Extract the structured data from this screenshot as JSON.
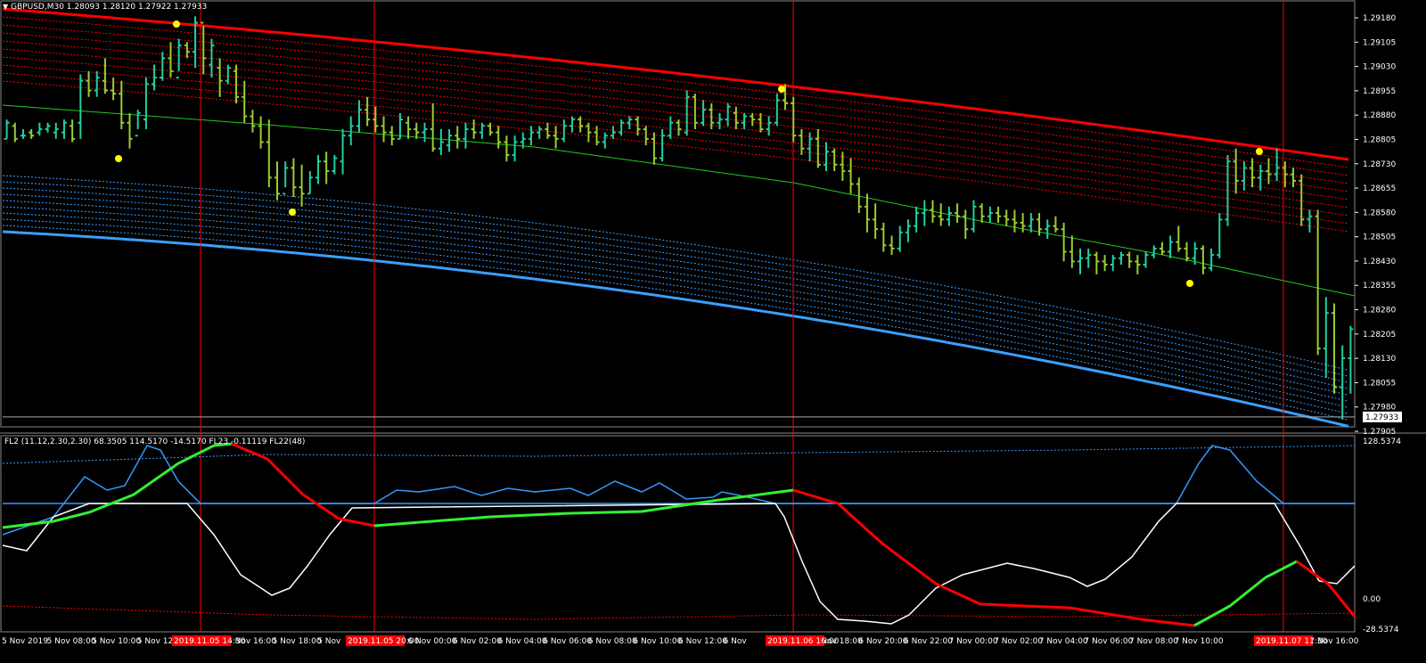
{
  "header": {
    "symbol_text": "GBPUSD,M30",
    "ohlc_text": "1.28093 1.28120 1.27922 1.27933",
    "menu_arrow": "triangle-down-icon"
  },
  "indicator_header": {
    "name_text": "FL2 (11.12,2.30,2.30) 68.3505 114.5170 -14.5170",
    "fl23_text": "FL23 -0.11119",
    "fl22_text": "FL22(48)"
  },
  "colors": {
    "background": "#000000",
    "bull_bar": "#20d0a0",
    "bear_bar": "#9acd32",
    "upper_band": "#ff0000",
    "lower_band": "#3aa0ff",
    "middle_line": "#22cc22",
    "fractal": "#ffff00",
    "separator": "#ff0000",
    "osc_up": "#33ee33",
    "osc_down": "#ff0000",
    "osc_blue": "#3399ff",
    "osc_white": "#ffffff"
  },
  "price_axis": {
    "labels": [
      "1.29180",
      "1.29105",
      "1.29030",
      "1.28955",
      "1.28880",
      "1.28805",
      "1.28730",
      "1.28655",
      "1.28580",
      "1.28505",
      "1.28430",
      "1.28355",
      "1.28280",
      "1.28205",
      "1.28130",
      "1.28055",
      "1.27980",
      "1.27905"
    ],
    "current_price": "1.27933"
  },
  "indicator_axis": {
    "top": "128.5374",
    "zero": "0.00",
    "bottom": "-28.5374"
  },
  "time_axis": {
    "labels": [
      "5 Nov 2019",
      "5 Nov 08:00",
      "5 Nov 10:00",
      "5 Nov 12:",
      "",
      "5 Nov 16:00",
      "5 Nov 18:00",
      "5 Nov",
      "",
      "6 Nov 00:00",
      "6 Nov 02:00",
      "6 Nov 04:00",
      "6 Nov 06:00",
      "6 Nov 08:00",
      "6 Nov 10:00",
      "6 Nov 12:00",
      "6 Nov",
      "",
      "6 Nov 18:00",
      "6 Nov 20:00",
      "6 Nov 22:00",
      "7 Nov 00:00",
      "7 Nov 02:00",
      "7 Nov 04:00",
      "7 Nov 06:00",
      "7 Nov 08:00",
      "7 Nov 10:00",
      "",
      "Nov 14:00",
      "7 Nov 16:00"
    ],
    "highlighted": [
      "2019.11.05 14:30",
      "2019.11.05 20:00",
      "2019.11.06 16:00",
      "2019.11.07 11:30"
    ]
  },
  "chart_data": {
    "type": "ohlc-bars",
    "symbol": "GBPUSD",
    "timeframe": "M30",
    "ylim": [
      1.27905,
      1.2922
    ],
    "bars": [
      [
        1.28795,
        1.28855,
        1.28795,
        1.28845
      ],
      [
        1.28835,
        1.28845,
        1.28785,
        1.28795
      ],
      [
        1.28805,
        1.28825,
        1.28795,
        1.28805
      ],
      [
        1.28815,
        1.28825,
        1.28795,
        1.28805
      ],
      [
        1.28815,
        1.28845,
        1.28805,
        1.28825
      ],
      [
        1.28825,
        1.28845,
        1.28815,
        1.28835
      ],
      [
        1.28815,
        1.28845,
        1.28795,
        1.28825
      ],
      [
        1.28815,
        1.28855,
        1.28795,
        1.28845
      ],
      [
        1.28835,
        1.28855,
        1.28785,
        1.28795
      ],
      [
        1.28845,
        1.28995,
        1.28795,
        1.28975
      ],
      [
        1.28975,
        1.29005,
        1.28925,
        1.28945
      ],
      [
        1.28945,
        1.29005,
        1.28925,
        1.28985
      ],
      [
        1.28975,
        1.29045,
        1.28935,
        1.28945
      ],
      [
        1.28945,
        1.28985,
        1.28915,
        1.28935
      ],
      [
        1.28935,
        1.28975,
        1.28825,
        1.28845
      ],
      [
        1.28845,
        1.28875,
        1.28765,
        1.28795
      ],
      [
        1.28805,
        1.28885,
        1.28825,
        1.28875
      ],
      [
        1.28855,
        1.28985,
        1.28825,
        1.28965
      ],
      [
        1.28965,
        1.29025,
        1.28945,
        1.28985
      ],
      [
        1.28985,
        1.29065,
        1.28975,
        1.29045
      ],
      [
        1.29045,
        1.29095,
        1.28985,
        1.29005
      ],
      [
        1.28985,
        1.29105,
        1.29005,
        1.29085
      ],
      [
        1.29085,
        1.29095,
        1.29045,
        1.29065
      ],
      [
        1.29065,
        1.29175,
        1.29015,
        1.29155
      ],
      [
        1.29155,
        1.29145,
        1.28995,
        1.29045
      ],
      [
        1.29025,
        1.29105,
        1.28985,
        1.29085
      ],
      [
        1.29015,
        1.29045,
        1.28925,
        1.28975
      ],
      [
        1.28975,
        1.29025,
        1.28965,
        1.29015
      ],
      [
        1.29005,
        1.29025,
        1.28905,
        1.28925
      ],
      [
        1.28925,
        1.28975,
        1.28845,
        1.28865
      ],
      [
        1.28865,
        1.28885,
        1.28815,
        1.28835
      ],
      [
        1.28835,
        1.28865,
        1.28765,
        1.28785
      ],
      [
        1.28785,
        1.28855,
        1.28645,
        1.28675
      ],
      [
        1.28675,
        1.28725,
        1.28605,
        1.28625
      ],
      [
        1.28625,
        1.28725,
        1.28645,
        1.28705
      ],
      [
        1.28705,
        1.28735,
        1.28615,
        1.28645
      ],
      [
        1.28645,
        1.28715,
        1.28585,
        1.28625
      ],
      [
        1.28625,
        1.28695,
        1.28625,
        1.28675
      ],
      [
        1.28675,
        1.28745,
        1.28655,
        1.28725
      ],
      [
        1.28725,
        1.28755,
        1.28655,
        1.28695
      ],
      [
        1.28695,
        1.28745,
        1.28685,
        1.28735
      ],
      [
        1.28725,
        1.28825,
        1.28685,
        1.28805
      ],
      [
        1.28805,
        1.28865,
        1.28775,
        1.28835
      ],
      [
        1.28835,
        1.28915,
        1.28815,
        1.28885
      ],
      [
        1.28885,
        1.28925,
        1.28835,
        1.28855
      ],
      [
        1.28855,
        1.28895,
        1.28815,
        1.28835
      ],
      [
        1.28835,
        1.28865,
        1.28785,
        1.28815
      ],
      [
        1.28815,
        1.28835,
        1.28775,
        1.28795
      ],
      [
        1.28795,
        1.28875,
        1.28795,
        1.28855
      ],
      [
        1.28845,
        1.28865,
        1.28795,
        1.28825
      ],
      [
        1.28825,
        1.28845,
        1.28795,
        1.28815
      ],
      [
        1.28815,
        1.28845,
        1.28785,
        1.28825
      ],
      [
        1.28825,
        1.28905,
        1.28755,
        1.28765
      ],
      [
        1.28765,
        1.28825,
        1.28745,
        1.28785
      ],
      [
        1.28775,
        1.28825,
        1.28755,
        1.28805
      ],
      [
        1.28805,
        1.28835,
        1.28765,
        1.28795
      ],
      [
        1.28795,
        1.28845,
        1.28765,
        1.28825
      ],
      [
        1.28825,
        1.28855,
        1.28795,
        1.28815
      ],
      [
        1.28815,
        1.28845,
        1.28795,
        1.28835
      ],
      [
        1.28835,
        1.28845,
        1.28805,
        1.28815
      ],
      [
        1.28815,
        1.28835,
        1.28765,
        1.28785
      ],
      [
        1.28785,
        1.28805,
        1.28725,
        1.28745
      ],
      [
        1.28745,
        1.28805,
        1.28725,
        1.28785
      ],
      [
        1.28785,
        1.28815,
        1.28765,
        1.28795
      ],
      [
        1.28795,
        1.28835,
        1.28775,
        1.28815
      ],
      [
        1.28815,
        1.28835,
        1.28795,
        1.28825
      ],
      [
        1.28825,
        1.28845,
        1.28795,
        1.28805
      ],
      [
        1.28805,
        1.28835,
        1.28765,
        1.28795
      ],
      [
        1.28795,
        1.28855,
        1.28785,
        1.28835
      ],
      [
        1.28835,
        1.28865,
        1.28815,
        1.28855
      ],
      [
        1.28855,
        1.28865,
        1.28815,
        1.28835
      ],
      [
        1.28835,
        1.28845,
        1.28785,
        1.28815
      ],
      [
        1.28815,
        1.28835,
        1.28775,
        1.28785
      ],
      [
        1.28785,
        1.28815,
        1.28765,
        1.28805
      ],
      [
        1.28805,
        1.28835,
        1.28795,
        1.28815
      ],
      [
        1.28815,
        1.28855,
        1.28805,
        1.28845
      ],
      [
        1.28845,
        1.28865,
        1.28825,
        1.28855
      ],
      [
        1.28855,
        1.28865,
        1.28805,
        1.28825
      ],
      [
        1.28825,
        1.28835,
        1.28775,
        1.28795
      ],
      [
        1.28795,
        1.28815,
        1.28715,
        1.28735
      ],
      [
        1.28735,
        1.28825,
        1.28725,
        1.28805
      ],
      [
        1.28805,
        1.28865,
        1.28795,
        1.28845
      ],
      [
        1.28845,
        1.28855,
        1.28805,
        1.28825
      ],
      [
        1.28815,
        1.28945,
        1.28805,
        1.28925
      ],
      [
        1.28925,
        1.28935,
        1.28825,
        1.28845
      ],
      [
        1.28845,
        1.28915,
        1.28835,
        1.28885
      ],
      [
        1.28885,
        1.28905,
        1.28825,
        1.28845
      ],
      [
        1.28845,
        1.28875,
        1.28825,
        1.28855
      ],
      [
        1.28855,
        1.28905,
        1.28835,
        1.28895
      ],
      [
        1.28875,
        1.28895,
        1.28825,
        1.28845
      ],
      [
        1.28845,
        1.28875,
        1.28825,
        1.28865
      ],
      [
        1.28865,
        1.28875,
        1.28835,
        1.28855
      ],
      [
        1.28855,
        1.28875,
        1.28815,
        1.28825
      ],
      [
        1.28825,
        1.28865,
        1.28805,
        1.28845
      ],
      [
        1.28845,
        1.28935,
        1.28835,
        1.28915
      ],
      [
        1.28915,
        1.28965,
        1.28885,
        1.28905
      ],
      [
        1.28905,
        1.28925,
        1.28785,
        1.28805
      ],
      [
        1.28805,
        1.28825,
        1.28745,
        1.28765
      ],
      [
        1.28765,
        1.28815,
        1.28725,
        1.28795
      ],
      [
        1.28795,
        1.28825,
        1.28705,
        1.28715
      ],
      [
        1.28715,
        1.28785,
        1.28695,
        1.28755
      ],
      [
        1.28755,
        1.28765,
        1.28695,
        1.28715
      ],
      [
        1.28715,
        1.28755,
        1.28665,
        1.28695
      ],
      [
        1.28695,
        1.28735,
        1.28625,
        1.28655
      ],
      [
        1.28655,
        1.28675,
        1.28565,
        1.28585
      ],
      [
        1.28585,
        1.28625,
        1.28505,
        1.28545
      ],
      [
        1.28545,
        1.28595,
        1.28485,
        1.28515
      ],
      [
        1.28515,
        1.28535,
        1.28445,
        1.28465
      ],
      [
        1.28465,
        1.28495,
        1.28435,
        1.28455
      ],
      [
        1.28455,
        1.28525,
        1.28445,
        1.28505
      ],
      [
        1.28505,
        1.28545,
        1.28475,
        1.28525
      ],
      [
        1.28525,
        1.28585,
        1.28505,
        1.28565
      ],
      [
        1.28565,
        1.28605,
        1.28525,
        1.28575
      ],
      [
        1.28575,
        1.28605,
        1.28535,
        1.28555
      ],
      [
        1.28555,
        1.28595,
        1.28525,
        1.28545
      ],
      [
        1.28545,
        1.28585,
        1.28525,
        1.28565
      ],
      [
        1.28565,
        1.28595,
        1.28535,
        1.28555
      ],
      [
        1.28555,
        1.28575,
        1.28485,
        1.28515
      ],
      [
        1.28515,
        1.28605,
        1.28505,
        1.28585
      ],
      [
        1.28585,
        1.28595,
        1.28535,
        1.28555
      ],
      [
        1.28555,
        1.28585,
        1.28535,
        1.28565
      ],
      [
        1.28565,
        1.28585,
        1.28535,
        1.28555
      ],
      [
        1.28555,
        1.28575,
        1.28525,
        1.28545
      ],
      [
        1.28545,
        1.28575,
        1.28505,
        1.28535
      ],
      [
        1.28535,
        1.28565,
        1.28505,
        1.28525
      ],
      [
        1.28525,
        1.28565,
        1.28505,
        1.28545
      ],
      [
        1.28545,
        1.28565,
        1.28495,
        1.28515
      ],
      [
        1.28515,
        1.28545,
        1.28485,
        1.28525
      ],
      [
        1.28525,
        1.28555,
        1.28505,
        1.28515
      ],
      [
        1.28515,
        1.28535,
        1.28415,
        1.28445
      ],
      [
        1.28445,
        1.28495,
        1.28395,
        1.28415
      ],
      [
        1.28415,
        1.28455,
        1.28375,
        1.28425
      ],
      [
        1.28425,
        1.28455,
        1.28395,
        1.28435
      ],
      [
        1.28435,
        1.28445,
        1.28375,
        1.28415
      ],
      [
        1.28415,
        1.28435,
        1.28385,
        1.28405
      ],
      [
        1.28405,
        1.28435,
        1.28385,
        1.28425
      ],
      [
        1.28425,
        1.28445,
        1.28405,
        1.28435
      ],
      [
        1.28435,
        1.28445,
        1.28395,
        1.28415
      ],
      [
        1.28415,
        1.28435,
        1.28375,
        1.28405
      ],
      [
        1.28405,
        1.28445,
        1.28395,
        1.28435
      ],
      [
        1.28435,
        1.28465,
        1.28425,
        1.28455
      ],
      [
        1.28455,
        1.28475,
        1.28435,
        1.28445
      ],
      [
        1.28445,
        1.28495,
        1.28425,
        1.28475
      ],
      [
        1.28475,
        1.28525,
        1.28445,
        1.28455
      ],
      [
        1.28455,
        1.28475,
        1.28415,
        1.28425
      ],
      [
        1.28425,
        1.28475,
        1.28405,
        1.28455
      ],
      [
        1.28455,
        1.28465,
        1.28375,
        1.28395
      ],
      [
        1.28395,
        1.28455,
        1.28385,
        1.28435
      ],
      [
        1.28435,
        1.28565,
        1.28425,
        1.28545
      ],
      [
        1.28545,
        1.28745,
        1.28525,
        1.28725
      ],
      [
        1.28725,
        1.28765,
        1.28625,
        1.28665
      ],
      [
        1.28665,
        1.28725,
        1.28635,
        1.28705
      ],
      [
        1.28705,
        1.28735,
        1.28645,
        1.28675
      ],
      [
        1.28675,
        1.28715,
        1.28635,
        1.28695
      ],
      [
        1.28695,
        1.28735,
        1.28655,
        1.28685
      ],
      [
        1.28685,
        1.28765,
        1.28665,
        1.28705
      ],
      [
        1.28705,
        1.28725,
        1.28645,
        1.28685
      ],
      [
        1.28685,
        1.28705,
        1.28645,
        1.28665
      ],
      [
        1.28665,
        1.28685,
        1.28525,
        1.28545
      ],
      [
        1.28545,
        1.28575,
        1.28505,
        1.28555
      ],
      [
        1.28555,
        1.28575,
        1.28125,
        1.28145
      ],
      [
        1.28145,
        1.28305,
        1.28055,
        1.28255
      ],
      [
        1.28255,
        1.28285,
        1.28005,
        1.28025
      ],
      [
        1.28025,
        1.28155,
        1.27925,
        1.28115
      ],
      [
        1.28115,
        1.28215,
        1.28005,
        1.28205
      ]
    ],
    "series": [
      {
        "name": "FL2"
      },
      {
        "name": "FL23"
      },
      {
        "name": "FL22(48)"
      }
    ]
  }
}
